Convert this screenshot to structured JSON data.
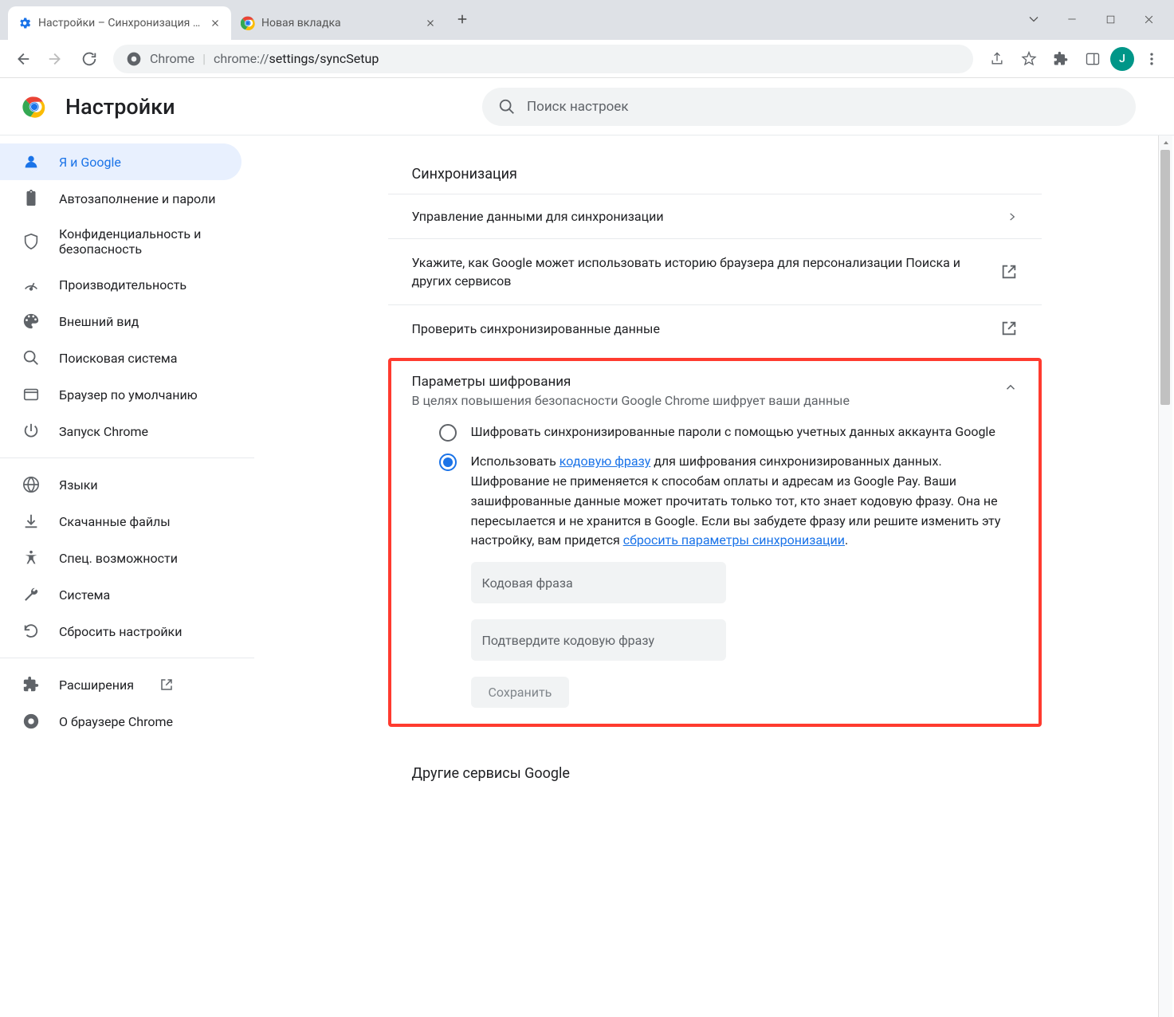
{
  "tabs": [
    {
      "title": "Настройки – Синхронизация се"
    },
    {
      "title": "Новая вкладка"
    }
  ],
  "omnibox": {
    "scheme_label": "Chrome",
    "url_prefix": "chrome://",
    "url_path": "settings/syncSetup"
  },
  "avatar_letter": "J",
  "app_title": "Настройки",
  "search_placeholder": "Поиск настроек",
  "sidebar": {
    "items": [
      {
        "label": "Я и Google"
      },
      {
        "label": "Автозаполнение и пароли"
      },
      {
        "label": "Конфиденциальность и безопасность"
      },
      {
        "label": "Производительность"
      },
      {
        "label": "Внешний вид"
      },
      {
        "label": "Поисковая система"
      },
      {
        "label": "Браузер по умолчанию"
      },
      {
        "label": "Запуск Chrome"
      }
    ],
    "items2": [
      {
        "label": "Языки"
      },
      {
        "label": "Скачанные файлы"
      },
      {
        "label": "Спец. возможности"
      },
      {
        "label": "Система"
      },
      {
        "label": "Сбросить настройки"
      }
    ],
    "items3": [
      {
        "label": "Расширения"
      },
      {
        "label": "О браузере Chrome"
      }
    ]
  },
  "sync": {
    "heading": "Синхронизация",
    "rows": {
      "manage": "Управление данными для синхронизации",
      "personalize": "Укажите, как Google может использовать историю браузера для персонализации Поиска и других сервисов",
      "review": "Проверить синхронизированные данные"
    },
    "encryption": {
      "title": "Параметры шифрования",
      "subtitle": "В целях повышения безопасности Google Chrome шифрует ваши данные",
      "opt1": "Шифровать синхронизированные пароли с помощью учетных данных аккаунта Google",
      "opt2_prefix": "Использовать ",
      "opt2_link1": "кодовую фразу",
      "opt2_mid": " для шифрования синхронизированных данных. Шифрование не применяется к способам оплаты и адресам из Google Pay. Ваши зашифрованные данные может прочитать только тот, кто знает кодовую фразу. Она не пересылается и не хранится в Google. Если вы забудете фразу или решите изменить эту настройку, вам придется ",
      "opt2_link2": "сбросить параметры синхронизации",
      "opt2_suffix": ".",
      "ph_passphrase": "Кодовая фраза",
      "ph_confirm": "Подтвердите кодовую фразу",
      "save": "Сохранить"
    },
    "other_services": "Другие сервисы Google"
  }
}
